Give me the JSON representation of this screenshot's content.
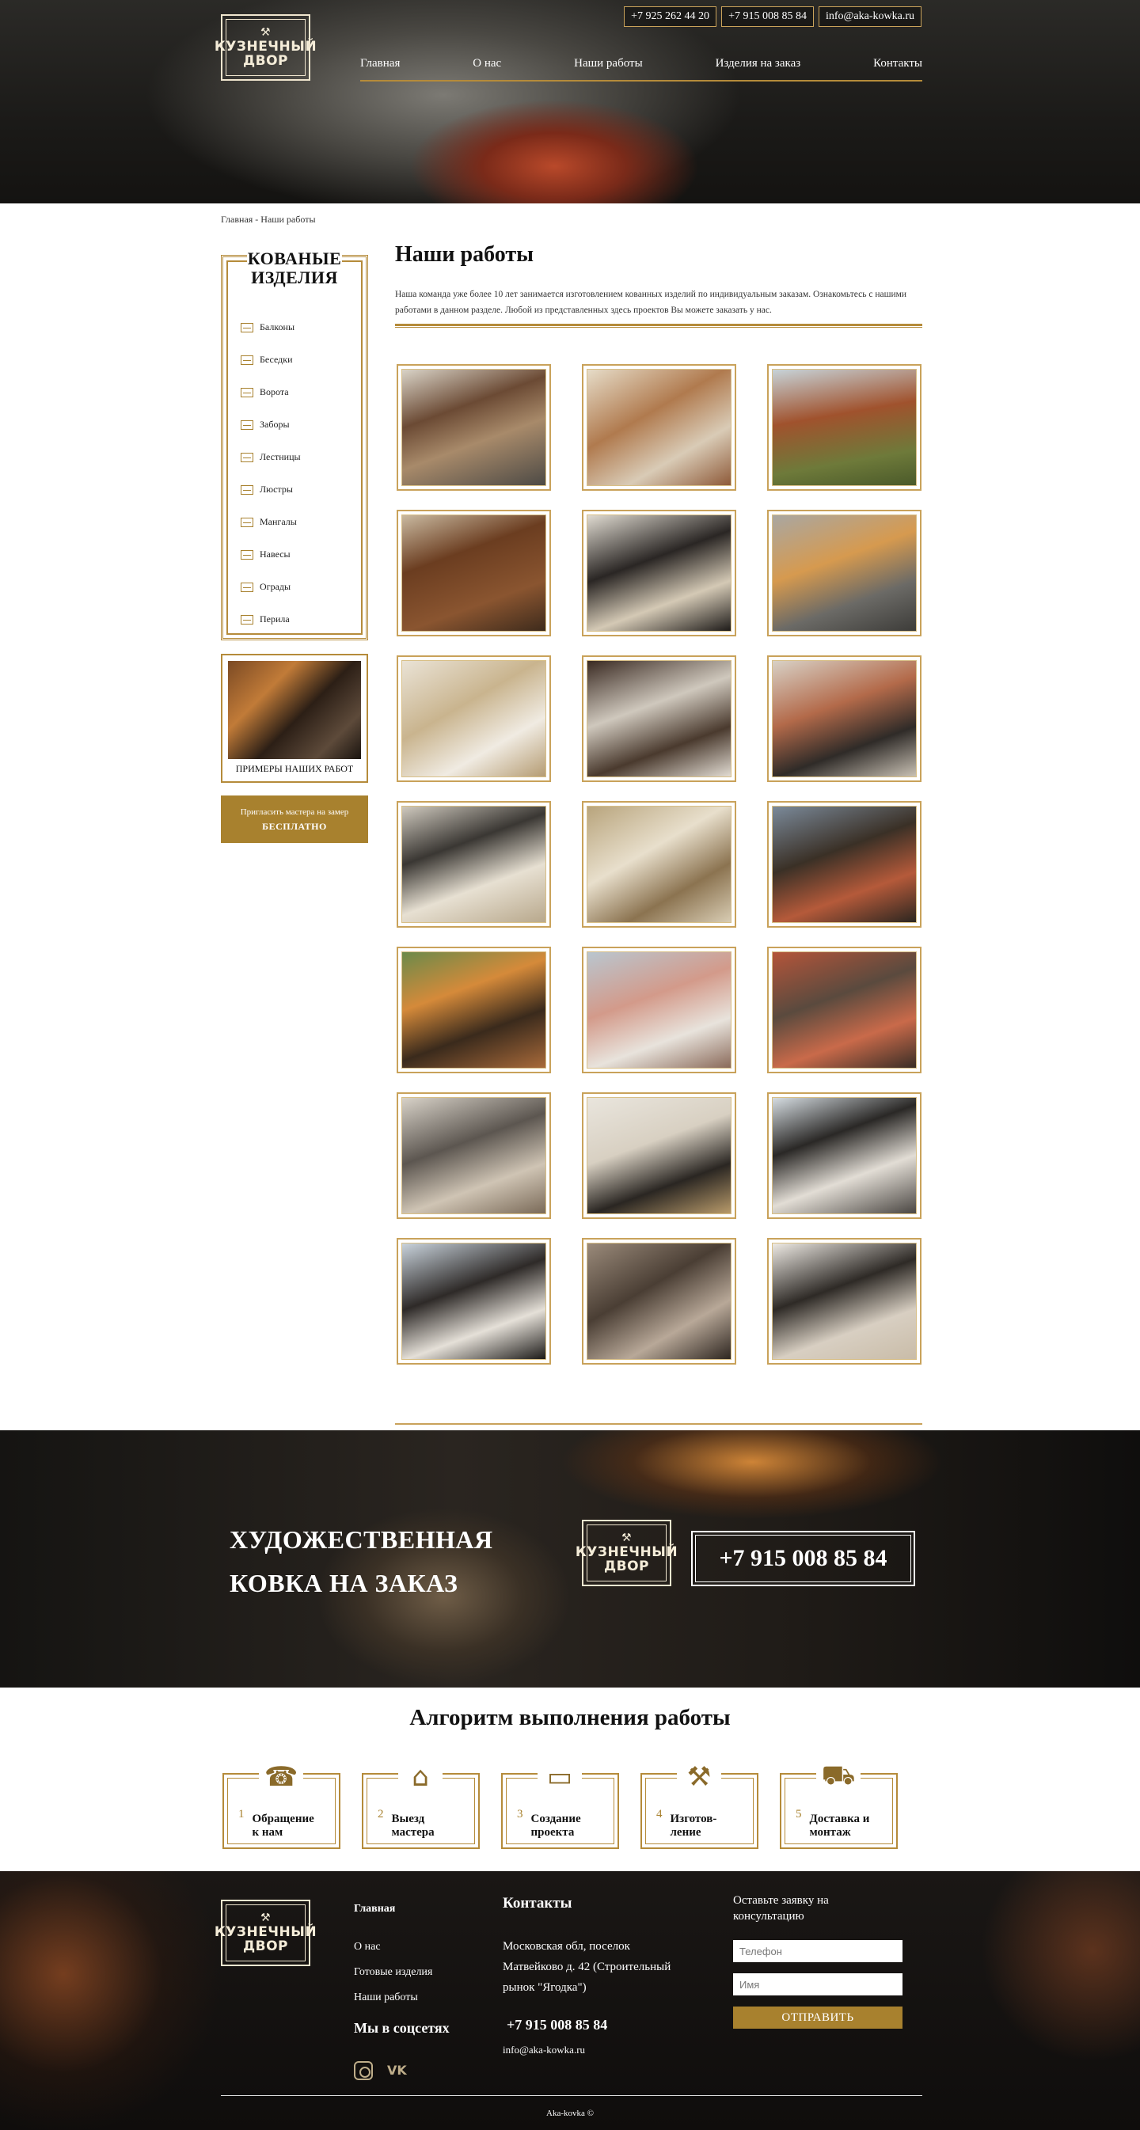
{
  "header": {
    "logo_line1": "КУЗНЕЧНЫЙ",
    "logo_line2": "ДВОР",
    "phones": [
      "+7 925 262 44 20",
      "+7 915 008 85 84"
    ],
    "email": "info@aka-kowka.ru",
    "nav": [
      "Главная",
      "О нас",
      "Наши работы",
      "Изделия на заказ",
      "Контакты"
    ]
  },
  "breadcrumb": "Главная - Наши работы",
  "sidebar": {
    "title": "КОВАНЫЕ ИЗДЕЛИЯ",
    "categories": [
      "Балконы",
      "Беседки",
      "Ворота",
      "Заборы",
      "Лестницы",
      "Люстры",
      "Мангалы",
      "Навесы",
      "Ограды",
      "Перила"
    ],
    "examples_caption": "ПРИМЕРЫ НАШИХ РАБОТ",
    "cta_line1": "Пригласить мастера на замер",
    "cta_line2": "БЕСПЛАТНО"
  },
  "main": {
    "title": "Наши работы",
    "intro": "Наша команда уже более 10 лет занимается изготовлением кованных изделий по индивидуальным заказам. Ознакомьтесь с нашими работами в данном разделе. Любой из представленных здесь проектов Вы можете заказать у нас.",
    "gallery_count": 21
  },
  "banner": {
    "line1": "ХУДОЖЕСТВЕННАЯ",
    "line2": "КОВКА НА ЗАКАЗ",
    "phone": "+7 915 008 85 84"
  },
  "algorithm": {
    "title": "Алгоритм выполнения работы",
    "steps": [
      {
        "num": "1",
        "label": "Обращение к нам",
        "icon": "headset-icon"
      },
      {
        "num": "2",
        "label": "Выезд мастера",
        "icon": "house-icon"
      },
      {
        "num": "3",
        "label": "Создание проекта",
        "icon": "monitor-icon"
      },
      {
        "num": "4",
        "label": "Изготов-ление",
        "icon": "anvil-icon"
      },
      {
        "num": "5",
        "label": "Доставка и монтаж",
        "icon": "truck-icon"
      }
    ]
  },
  "footer": {
    "links": [
      "Главная",
      "О нас",
      "Готовые изделия",
      "Наши работы"
    ],
    "social_title": "Мы в соцсетях",
    "contacts_title": "Контакты",
    "address": "Московская обл, поселок Матвейково д. 42 (Строительный рынок \"Ягодка\")",
    "phone": "+7 915 008 85 84",
    "email": "info@aka-kowka.ru",
    "form_title": "Оставьте заявку на консультацию",
    "phone_placeholder": "Телефон",
    "name_placeholder": "Имя",
    "submit_label": "ОТПРАВИТЬ",
    "copyright": "Aka-kovka ©"
  },
  "colors": {
    "accent": "#a8812e",
    "accent_light": "#c9a25a"
  }
}
